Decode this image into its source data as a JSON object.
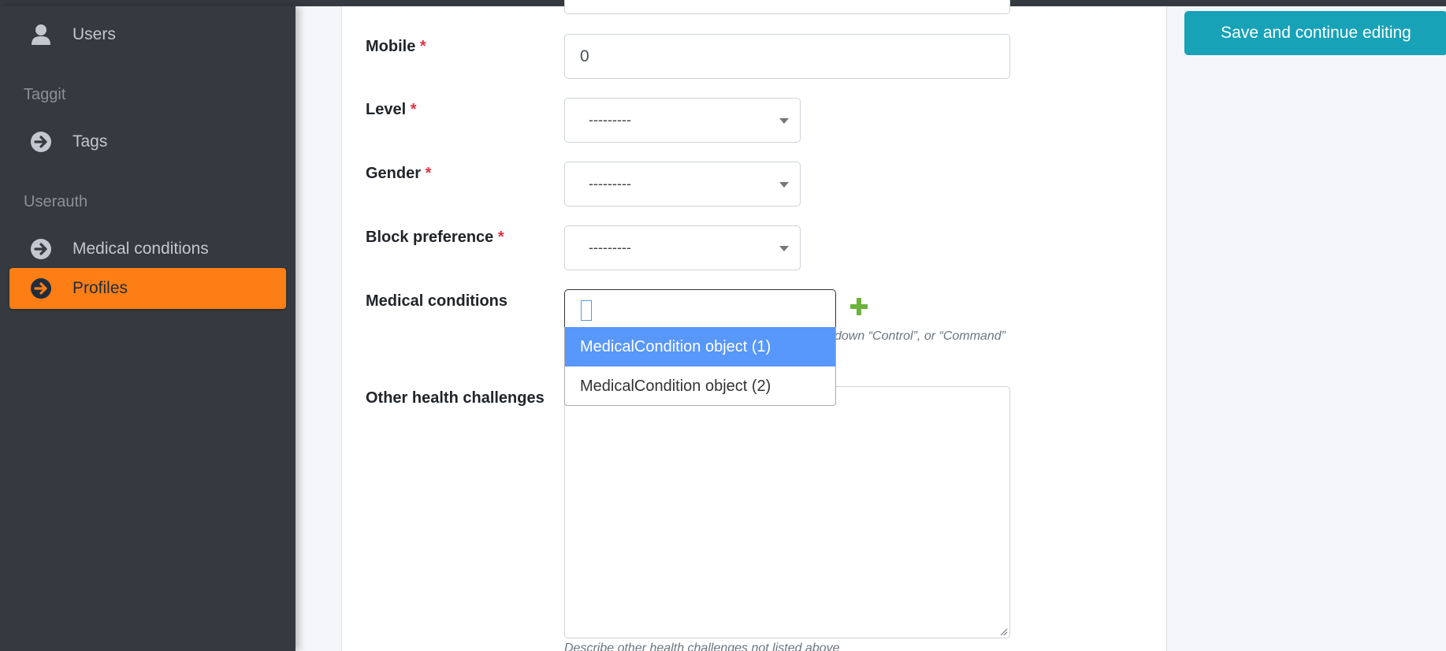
{
  "sidebar": {
    "users_label": "Users",
    "section_taggit": "Taggit",
    "tags_label": "Tags",
    "section_userauth": "Userauth",
    "medical_conditions_label": "Medical conditions",
    "profiles_label": "Profiles",
    "active_color": "#fd7e14"
  },
  "form": {
    "mobile": {
      "label": "Mobile",
      "required_mark": "*",
      "value": "0"
    },
    "level": {
      "label": "Level",
      "required_mark": "*",
      "selected": "---------"
    },
    "gender": {
      "label": "Gender",
      "required_mark": "*",
      "selected": "---------"
    },
    "block_preference": {
      "label": "Block preference",
      "required_mark": "*",
      "selected": "---------"
    },
    "medical_conditions": {
      "label": "Medical conditions",
      "help_text": "down “Control”, or “Command”",
      "options": [
        "MedicalCondition object (1)",
        "MedicalCondition object (2)"
      ],
      "highlighted_index": 0
    },
    "other_health": {
      "label": "Other health challenges",
      "help_text": "Describe other health challenges not listed above"
    }
  },
  "actions": {
    "save_continue_label": "Save and continue editing",
    "button_color": "#17a2b8",
    "add_icon_color": "#6cb33e"
  }
}
